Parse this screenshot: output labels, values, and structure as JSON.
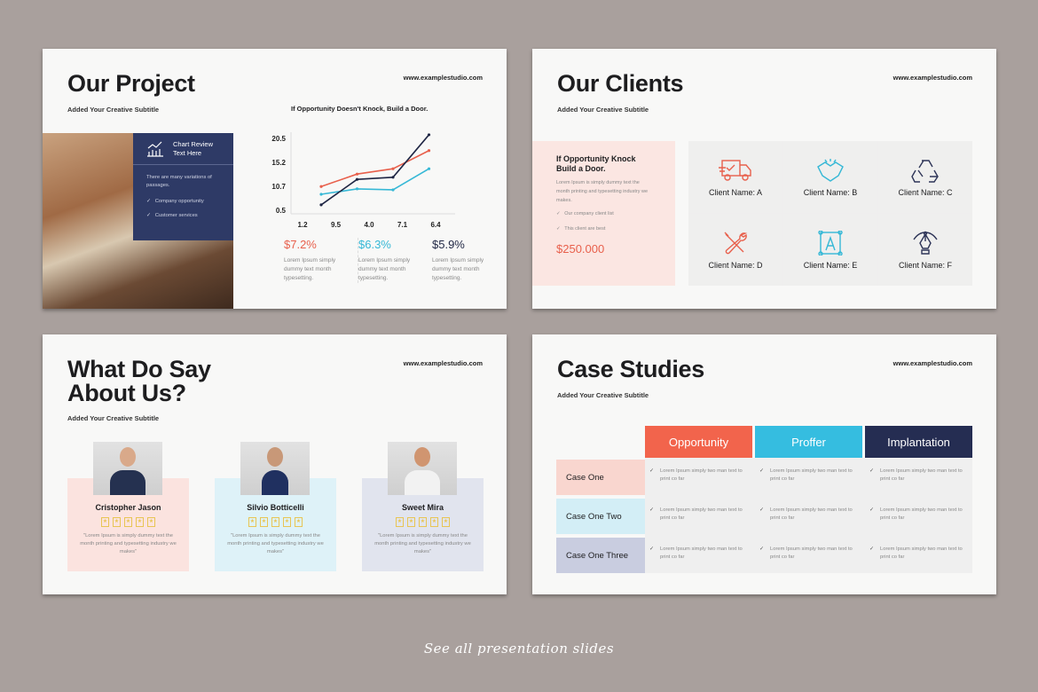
{
  "background_color": "#a9a09d",
  "url": "www.examplestudio.com",
  "slides": {
    "project": {
      "title": "Our Project",
      "subtitle": "Added Your Creative Subtitle",
      "chart_heading": "If Opportunity  Doesn't Knock, Build a Door.",
      "box": {
        "icon": "chart-review-icon",
        "title_l1": "Chart Review",
        "title_l2": "Text Here",
        "text": "There are many variations of passages.",
        "items": [
          "Company opportunity",
          "Customer services"
        ]
      },
      "stats": [
        {
          "value": "$7.2%",
          "color": "#e8604c",
          "text": "Lorem Ipsum simply dummy text month typesetting."
        },
        {
          "value": "$6.3%",
          "color": "#36b8d6",
          "text": "Lorem Ipsum simply dummy text month typesetting."
        },
        {
          "value": "$5.9%",
          "color": "#1f2644",
          "text": "Lorem Ipsum simply dummy text month typesetting."
        }
      ]
    },
    "clients": {
      "title": "Our Clients",
      "subtitle": "Added Your Creative Subtitle",
      "box": {
        "heading_l1": "If Opportunity Knock",
        "heading_l2": "Build a Door.",
        "text": "Lorem Ipsum is simply dummy text  the month printing and typesetting industry we makes.",
        "items": [
          "Our company client list",
          "This client are best"
        ],
        "amount": "$250.000"
      },
      "items": [
        {
          "label": "Client Name: A",
          "icon": "delivery-truck-icon",
          "color": "#e8604c"
        },
        {
          "label": "Client Name: B",
          "icon": "handshake-icon",
          "color": "#36b8d6"
        },
        {
          "label": "Client Name: C",
          "icon": "recycle-icon",
          "color": "#2e3558"
        },
        {
          "label": "Client Name: D",
          "icon": "tools-icon",
          "color": "#e8604c"
        },
        {
          "label": "Client Name: E",
          "icon": "vector-design-icon",
          "color": "#36b8d6"
        },
        {
          "label": "Client Name: F",
          "icon": "pen-tool-icon",
          "color": "#2e3558"
        }
      ]
    },
    "testimonials": {
      "title_l1": "What Do Say",
      "title_l2": "About Us?",
      "subtitle": "Added Your Creative Subtitle",
      "people": [
        {
          "name": "Cristopher Jason",
          "quote": "\"Lorem Ipsum is simply dummy text the month printing and typesetting industry we makes\"",
          "bg": "#fbe3df",
          "rating": 5
        },
        {
          "name": "Silvio Botticelli",
          "quote": "\"Lorem Ipsum is simply dummy text the month printing and typesetting industry we makes\"",
          "bg": "#def2f8",
          "rating": 5
        },
        {
          "name": "Sweet Mira",
          "quote": "\"Lorem Ipsum is simply dummy text the month printing and typesetting industry we makes\"",
          "bg": "#e1e4ee",
          "rating": 5
        }
      ]
    },
    "cases": {
      "title": "Case Studies",
      "subtitle": "Added Your Creative Subtitle",
      "columns": [
        {
          "label": "Opportunity",
          "color": "#f2644c"
        },
        {
          "label": "Proffer",
          "color": "#35bde0"
        },
        {
          "label": "Implantation",
          "color": "#252d52"
        }
      ],
      "rows": [
        {
          "label": "Case One",
          "color": "#f9d6cf"
        },
        {
          "label": "Case One Two",
          "color": "#d3eef6"
        },
        {
          "label": "Case One Three",
          "color": "#c9cde0"
        }
      ],
      "cell_text": "Lorem Ipsum simply two man text to print co far"
    }
  },
  "chart_data": {
    "type": "line",
    "title": "If Opportunity  Doesn't Knock, Build a Door.",
    "categories": [
      "1.2",
      "9.5",
      "4.0",
      "7.1",
      "6.4"
    ],
    "y_ticks": [
      "0.5",
      "10.7",
      "15.2",
      "20.5"
    ],
    "grid": false,
    "series": [
      {
        "color": "#e8604c",
        "values": [
          10.6,
          13.0,
          14.0,
          17.8
        ]
      },
      {
        "color": "#36b8d6",
        "values": [
          7.3,
          9.6,
          9.2,
          14.0
        ]
      },
      {
        "color": "#1f2644",
        "values": [
          2.8,
          12.0,
          12.4,
          21.3
        ]
      }
    ]
  },
  "footer": "See all presentation slides"
}
